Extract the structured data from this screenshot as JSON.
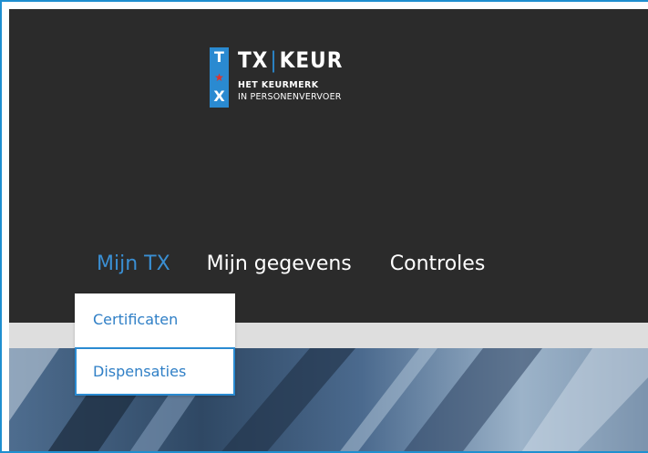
{
  "logo": {
    "badge_letters": [
      "T",
      "★",
      "X"
    ],
    "title_left": "TX",
    "title_sep": "|",
    "title_right": "KEUR",
    "subtitle_line1": "HET KEURMERK",
    "subtitle_line2": "IN PERSONENVERVOER"
  },
  "nav": {
    "items": [
      {
        "label": "Mijn TX",
        "active": true
      },
      {
        "label": "Mijn gegevens",
        "active": false
      },
      {
        "label": "Controles",
        "active": false
      }
    ]
  },
  "dropdown": {
    "items": [
      {
        "label": "Certificaten"
      },
      {
        "label": "Dispensaties"
      }
    ]
  },
  "colors": {
    "header_bg": "#2b2b2b",
    "accent": "#2a8ad1",
    "active_nav": "#3a8fd3",
    "dropdown_text": "#2f7fc6",
    "band": "#dedede",
    "logo_star": "#e0322b"
  }
}
